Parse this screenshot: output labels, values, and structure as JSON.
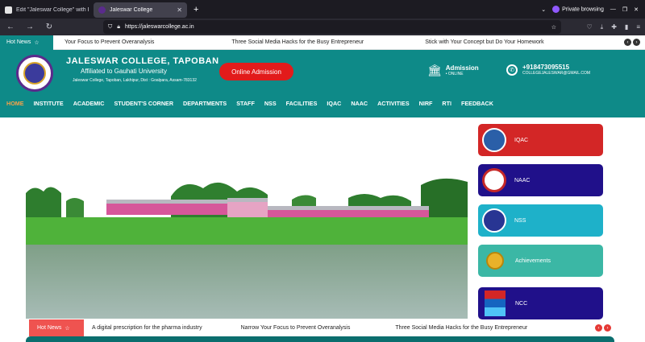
{
  "browser": {
    "tabs": [
      {
        "title": "Edit \"Jaleswar College\" with Ele"
      },
      {
        "title": "Jaleswar College"
      }
    ],
    "new_tab": "+",
    "private_label": "Private browsing",
    "url": "https://jaleswarcollege.ac.in"
  },
  "hot_news_top": {
    "label": "Hot News",
    "items": [
      "Your Focus to Prevent Overanalysis",
      "Three Social Media Hacks for the Busy Entrepreneur",
      "Stick with Your Concept but Do Your Homework"
    ]
  },
  "header": {
    "college_name": "JALESWAR COLLEGE, TAPOBAN",
    "affiliation": "Affiliated to Gauhati University",
    "address": "Jaleswar College, Tapoban, Lakhipur, Dist : Goalpara, Assam-783132",
    "admission_button": "Online Admission",
    "admission_title": "Admission",
    "admission_sub": "• ONLINE",
    "phone": "+918473095515",
    "email": "COLLEGEJALESWAR@GMAIL.COM"
  },
  "menu": [
    "HOME",
    "INSTITUTE",
    "ACADEMIC",
    "STUDENT'S CORNER",
    "DEPARTMENTS",
    "STAFF",
    "NSS",
    "FACILITIES",
    "IQAC",
    "NAAC",
    "ACTIVITIES",
    "NIRF",
    "RTI",
    "FEEDBACK"
  ],
  "side_buttons": [
    {
      "label": "IQAC",
      "color": "#d32626"
    },
    {
      "label": "NAAC",
      "color": "#20108a"
    },
    {
      "label": "NSS",
      "color": "#1eb1c9"
    },
    {
      "label": "Achievements",
      "color": "#3bb7a5"
    },
    {
      "label": "NCC",
      "color": "#20108a"
    }
  ],
  "hot_news_bottom": {
    "label": "Hot News",
    "items": [
      "A digital prescription for the pharma industry",
      "Narrow Your Focus to Prevent Overanalysis",
      "Three Social Media Hacks for the Busy Entrepreneur"
    ]
  },
  "colors": {
    "brand": "#0e8a88",
    "accent": "#e21b1b"
  }
}
